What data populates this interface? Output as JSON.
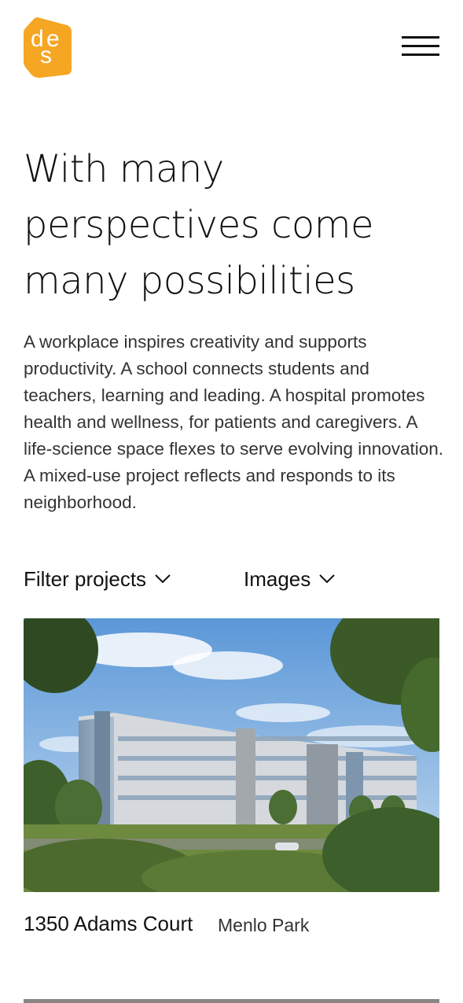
{
  "brand": {
    "logo_letters": [
      "d",
      "e",
      "s"
    ],
    "logo_color": "#F5A623"
  },
  "header": {
    "menu_icon": "hamburger-menu-icon"
  },
  "hero": {
    "headline_lines": [
      "With many",
      "perspectives come",
      "many possibilities"
    ],
    "intro": "A workplace inspires creativity and supports productivity. A school connects students and teachers, learning and leading. A hospital promotes health and wellness, for patients and caregivers. A life-science space flexes to serve evolving innovation. A mixed-use project reflects and responds to its neighborhood."
  },
  "filters": {
    "filter_label": "Filter projects",
    "view_label": "Images",
    "chevron_icon": "chevron-down-icon"
  },
  "projects": [
    {
      "name": "1350 Adams Court",
      "location": "Menlo Park"
    }
  ]
}
